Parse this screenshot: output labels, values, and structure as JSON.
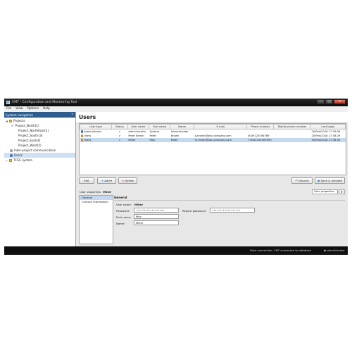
{
  "window": {
    "title": "CMT - Configuration and Monitoring Tool",
    "controls": [
      "–",
      "□",
      "✕"
    ]
  },
  "menu": [
    "File",
    "View",
    "Options",
    "Help"
  ],
  "nav": {
    "header": "System navigation",
    "pin": "«",
    "items": [
      {
        "label": "Projects"
      },
      {
        "label": "Project_North(1)"
      },
      {
        "label": "Project_NorthEast(2)"
      },
      {
        "label": "Project_South(3)"
      },
      {
        "label": "Project_East(4)"
      },
      {
        "label": "Project_West(5)"
      },
      {
        "label": "Inter-project communication"
      },
      {
        "label": "Users"
      },
      {
        "label": "TCSS system"
      }
    ]
  },
  "main": {
    "title": "Users",
    "grid": {
      "columns": [
        "User type",
        "Status",
        "User name",
        "First name",
        "Name",
        "E-mail",
        "Phone number",
        "Mobile phone number",
        "Last logon"
      ],
      "rows": [
        {
          "type": "Administrator",
          "status": "✔",
          "username": "administrator",
          "first": "System",
          "name": "Administrator",
          "email": "",
          "phone": "",
          "mobile": "",
          "last": "20/Feb/2018 17:39:09",
          "color": "#3d6fb8"
        },
        {
          "type": "Users",
          "status": "✔",
          "username": "Peter Brown",
          "first": "Peter",
          "name": "Brown",
          "email": "p.brown@abc-company.com",
          "phone": "0049123456789",
          "mobile": "",
          "last": "20/Feb/2018 17:38:29",
          "color": "#d88a2a"
        },
        {
          "type": "Users",
          "status": "✔",
          "username": "Miller",
          "first": "Max",
          "name": "Miller",
          "email": "m.miller@abc-company.com",
          "phone": "+0041234567890",
          "mobile": "",
          "last": "20/Feb/2018 17:38:45",
          "color": "#d88a2a"
        }
      ]
    },
    "buttons": {
      "edit": "Edit",
      "add": "Add",
      "delete": "Delete",
      "discard": "Discard",
      "save": "Save & activate"
    },
    "properties": {
      "label": "User properties",
      "user": "Miller",
      "selector": "User properties",
      "tabs": [
        "General",
        "Contact information"
      ],
      "section": "General",
      "username_label": "User name:",
      "username_value": "Miller",
      "password_label": "Password:",
      "password_value": "••••••••••••••••••",
      "repeat_label": "Repeat password:",
      "repeat_value": "••••••••••••••••••",
      "first_label": "First name:",
      "first_value": "Max",
      "name_label": "Name:",
      "name_value": "Miller"
    }
  },
  "status": {
    "connection": "Data connection: CMT connected to database",
    "user": "administrator"
  }
}
